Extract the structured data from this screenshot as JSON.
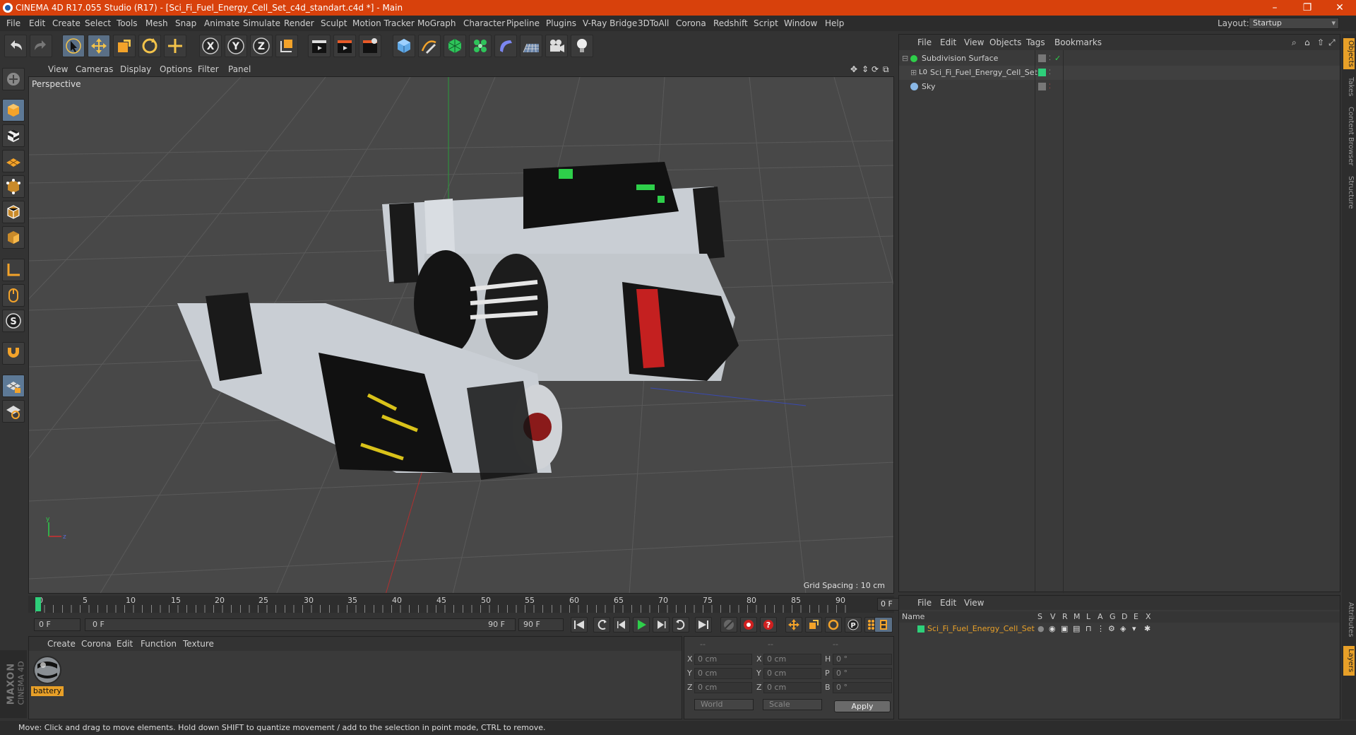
{
  "title": "CINEMA 4D R17.055 Studio (R17) - [Sci_Fi_Fuel_Energy_Cell_Set_c4d_standart.c4d *] - Main",
  "menu": [
    "File",
    "Edit",
    "Create",
    "Select",
    "Tools",
    "Mesh",
    "Snap",
    "Animate",
    "Simulate",
    "Render",
    "Sculpt",
    "Motion Tracker",
    "MoGraph",
    "Character",
    "Pipeline",
    "Plugins",
    "V-Ray Bridge",
    "3DToAll",
    "Corona",
    "Redshift",
    "Script",
    "Window",
    "Help"
  ],
  "layout": {
    "label": "Layout:",
    "value": "Startup"
  },
  "viewport": {
    "menu": [
      "View",
      "Cameras",
      "Display",
      "Options",
      "Filter",
      "Panel"
    ],
    "label": "Perspective",
    "grid_spacing": "Grid Spacing : 10 cm"
  },
  "timeline": {
    "ticks": [
      "0",
      "5",
      "10",
      "15",
      "20",
      "25",
      "30",
      "35",
      "40",
      "45",
      "50",
      "55",
      "60",
      "65",
      "70",
      "75",
      "80",
      "85",
      "90"
    ],
    "current": "0 F",
    "start": "0 F",
    "range_start": "0 F",
    "range_end": "90 F",
    "end": "90 F"
  },
  "material_panel": {
    "menu": [
      "Create",
      "Corona",
      "Edit",
      "Function",
      "Texture"
    ],
    "material_name": "battery"
  },
  "coord_panel": {
    "headers": [
      "--",
      "--",
      "--"
    ],
    "rows": [
      {
        "l1": "X",
        "v1": "0 cm",
        "l2": "X",
        "v2": "0 cm",
        "l3": "H",
        "v3": "0 °"
      },
      {
        "l1": "Y",
        "v1": "0 cm",
        "l2": "Y",
        "v2": "0 cm",
        "l3": "P",
        "v3": "0 °"
      },
      {
        "l1": "Z",
        "v1": "0 cm",
        "l2": "Z",
        "v2": "0 cm",
        "l3": "B",
        "v3": "0 °"
      }
    ],
    "dropdown1": "World",
    "dropdown2": "Scale",
    "apply": "Apply"
  },
  "object_manager": {
    "menu": [
      "File",
      "Edit",
      "View",
      "Objects",
      "Tags",
      "Bookmarks"
    ],
    "objects": [
      {
        "name": "Subdivision Surface",
        "color": "#9cd0ff"
      },
      {
        "name": "Sci_Fi_Fuel_Energy_Cell_Set",
        "color": "#ffffff"
      },
      {
        "name": "Sky",
        "color": "#9cd0ff"
      }
    ]
  },
  "attribute_manager": {
    "menu": [
      "File",
      "Edit",
      "View"
    ],
    "columns": [
      "Name",
      "S",
      "V",
      "R",
      "M",
      "L",
      "A",
      "G",
      "D",
      "E",
      "X"
    ],
    "layer_name": "Sci_Fi_Fuel_Energy_Cell_Set"
  },
  "right_tabs": [
    "Objects",
    "Takes",
    "Content Browser",
    "Structure",
    "Attributes",
    "Layers"
  ],
  "brand": {
    "line1": "MAXON",
    "line2": "CINEMA 4D"
  },
  "status": "Move: Click and drag to move elements. Hold down SHIFT to quantize movement / add to the selection in point mode, CTRL to remove.",
  "colors": {
    "titlebar": "#d8410c",
    "accent": "#e8a028",
    "layer_green": "#2ecf7a"
  }
}
